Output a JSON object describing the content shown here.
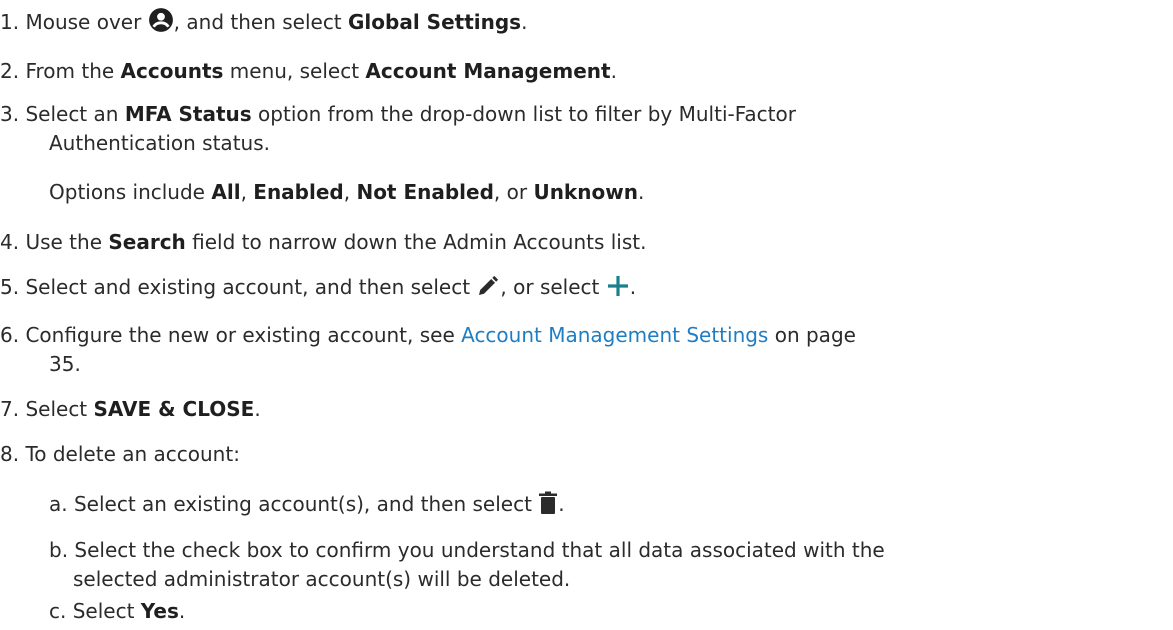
{
  "steps": [
    {
      "num": "1.",
      "pre": "Mouse over",
      "icon": "account-circle-icon",
      "mid": ", and then select",
      "bold": "Global Settings",
      "post": "."
    },
    {
      "num": "2.",
      "pre": "From the",
      "bold1": "Accounts",
      "mid": "menu, select",
      "bold2": "Account Management",
      "post": "."
    },
    {
      "num": "3.",
      "pre": "Select an",
      "bold": "MFA Status",
      "post": "option from the drop-down list to filter by Multi-Factor",
      "line2": "Authentication status.",
      "options_pre": "Options include",
      "opt1": "All",
      "opt2": "Enabled",
      "opt3": "Not Enabled",
      "opt_or": ", or",
      "opt4": "Unknown",
      "options_post": "."
    },
    {
      "num": "4.",
      "pre": "Use the",
      "bold": "Search",
      "post": "field to narrow down the Admin Accounts list."
    },
    {
      "num": "5.",
      "pre": "Select and existing account, and then select",
      "icon1": "pencil-icon",
      "mid": ", or select",
      "icon2": "plus-icon",
      "post": "."
    },
    {
      "num": "6.",
      "pre": "Configure the new or existing account, see",
      "link": "Account Management Settings",
      "post": "on page",
      "line2": "35."
    },
    {
      "num": "7.",
      "pre": "Select",
      "bold": "SAVE & CLOSE",
      "post": "."
    },
    {
      "num": "8.",
      "text": "To delete an account:",
      "substeps": [
        {
          "label": "a.",
          "pre": "Select an existing account(s), and then select",
          "icon": "trash-icon",
          "post": "."
        },
        {
          "label": "b.",
          "text": "Select the check box to confirm you understand that all data associated with the",
          "line2": "selected administrator account(s) will be deleted."
        },
        {
          "label": "c.",
          "pre": "Select",
          "bold": "Yes",
          "post": "."
        }
      ]
    }
  ],
  "colors": {
    "text": "#2b2b2b",
    "link": "#1f7ec2",
    "plus": "#1a7f8e"
  }
}
